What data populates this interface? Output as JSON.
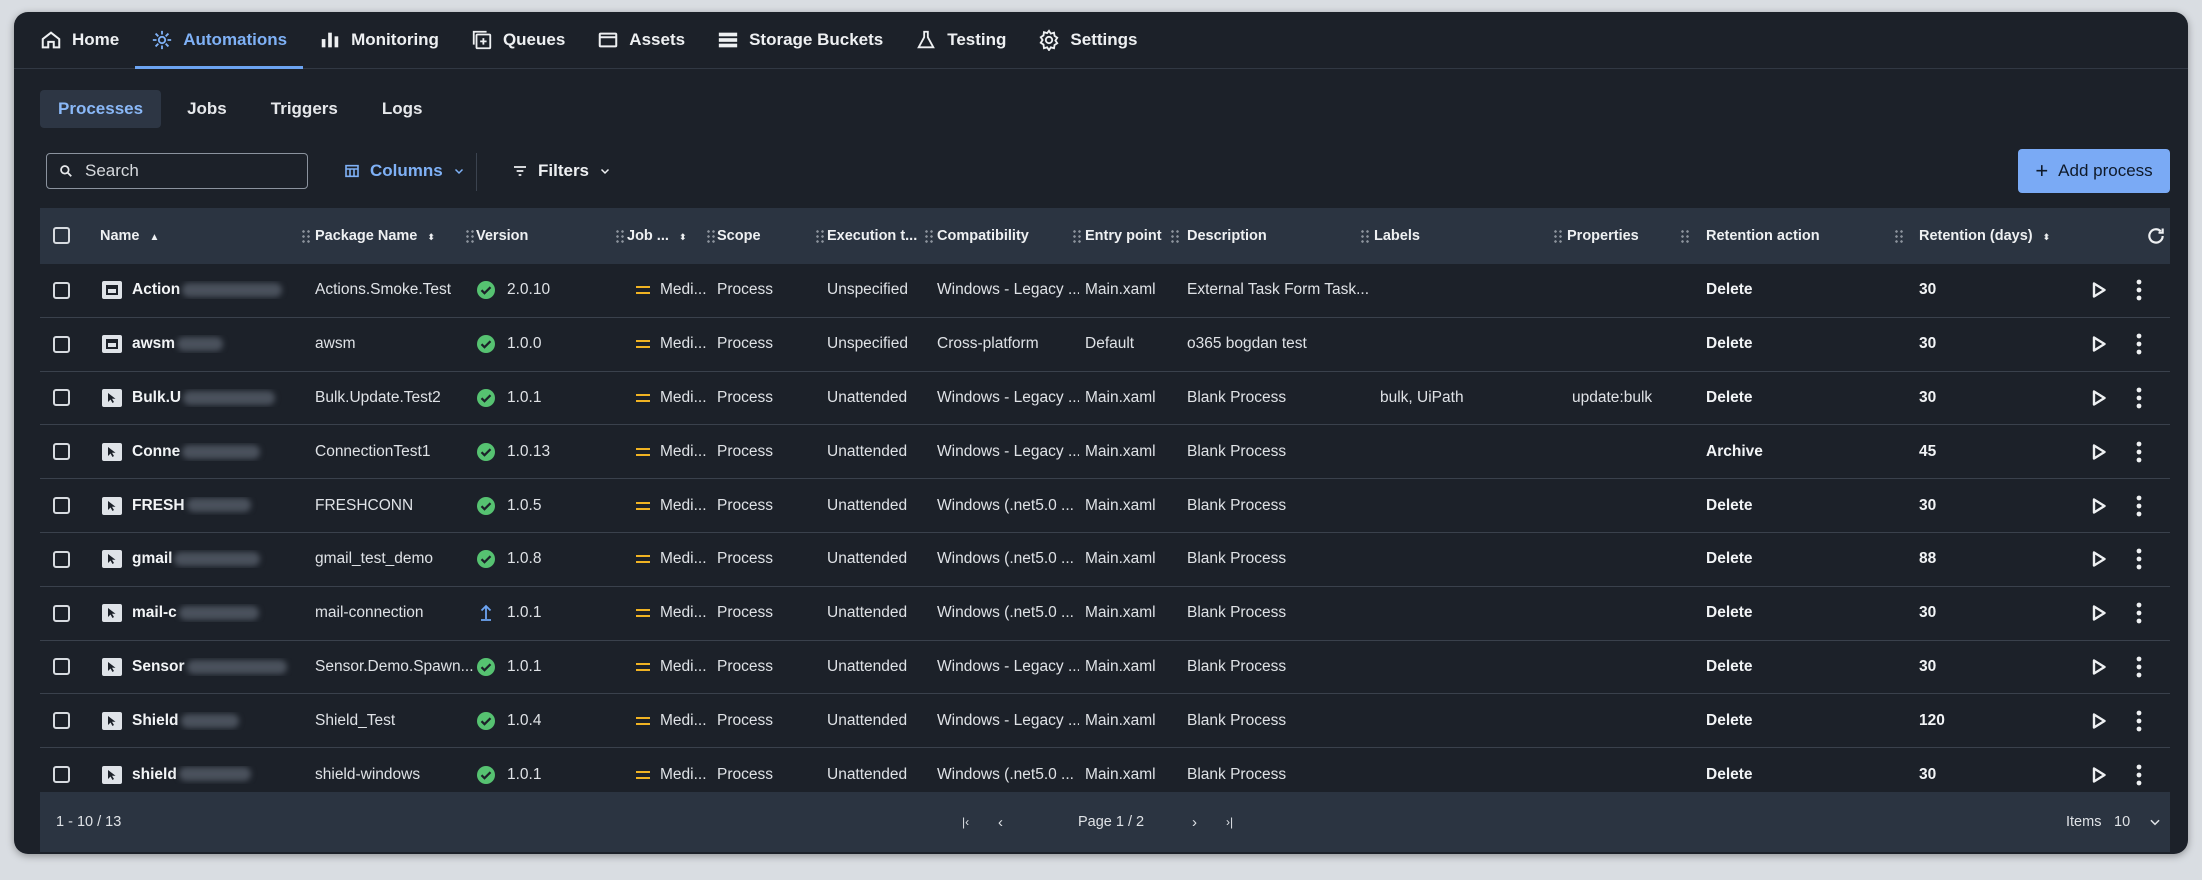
{
  "nav": {
    "items": [
      {
        "label": "Home",
        "icon": "home-icon"
      },
      {
        "label": "Automations",
        "icon": "automations-icon"
      },
      {
        "label": "Monitoring",
        "icon": "monitoring-icon"
      },
      {
        "label": "Queues",
        "icon": "queues-icon"
      },
      {
        "label": "Assets",
        "icon": "assets-icon"
      },
      {
        "label": "Storage Buckets",
        "icon": "storage-icon"
      },
      {
        "label": "Testing",
        "icon": "flask-icon"
      },
      {
        "label": "Settings",
        "icon": "gear-icon"
      }
    ],
    "active": "Automations"
  },
  "subtabs": {
    "items": [
      "Processes",
      "Jobs",
      "Triggers",
      "Logs"
    ],
    "active": "Processes"
  },
  "toolbar": {
    "search_placeholder": "Search",
    "columns_label": "Columns",
    "filters_label": "Filters",
    "add_label": "Add process"
  },
  "table": {
    "headers": {
      "name": "Name",
      "package": "Package Name",
      "version": "Version",
      "job": "Job ...",
      "scope": "Scope",
      "execution": "Execution t...",
      "compatibility": "Compatibility",
      "entry": "Entry point",
      "description": "Description",
      "labels": "Labels",
      "properties": "Properties",
      "retention_action": "Retention action",
      "retention_days": "Retention (days)"
    },
    "rows": [
      {
        "name": "Action",
        "type": "attended",
        "package": "Actions.Smoke.Test",
        "version": "2.0.10",
        "version_status": "ok",
        "job": "Medi...",
        "scope": "Process",
        "execution": "Unspecified",
        "compatibility": "Windows - Legacy ...",
        "entry": "Main.xaml",
        "description": "External Task Form Task...",
        "labels": "",
        "properties": "",
        "retention_action": "Delete",
        "retention_days": "30"
      },
      {
        "name": "awsm",
        "type": "attended",
        "package": "awsm",
        "version": "1.0.0",
        "version_status": "ok",
        "job": "Medi...",
        "scope": "Process",
        "execution": "Unspecified",
        "compatibility": "Cross-platform",
        "entry": "Default",
        "description": "o365 bogdan test",
        "labels": "",
        "properties": "",
        "retention_action": "Delete",
        "retention_days": "30"
      },
      {
        "name": "Bulk.U",
        "type": "unattended",
        "package": "Bulk.Update.Test2",
        "version": "1.0.1",
        "version_status": "ok",
        "job": "Medi...",
        "scope": "Process",
        "execution": "Unattended",
        "compatibility": "Windows - Legacy ...",
        "entry": "Main.xaml",
        "description": "Blank Process",
        "labels": "bulk, UiPath",
        "properties": "update:bulk",
        "retention_action": "Delete",
        "retention_days": "30"
      },
      {
        "name": "Conne",
        "type": "unattended",
        "package": "ConnectionTest1",
        "version": "1.0.13",
        "version_status": "ok",
        "job": "Medi...",
        "scope": "Process",
        "execution": "Unattended",
        "compatibility": "Windows - Legacy ...",
        "entry": "Main.xaml",
        "description": "Blank Process",
        "labels": "",
        "properties": "",
        "retention_action": "Archive",
        "retention_days": "45"
      },
      {
        "name": "FRESH",
        "type": "unattended",
        "package": "FRESHCONN",
        "version": "1.0.5",
        "version_status": "ok",
        "job": "Medi...",
        "scope": "Process",
        "execution": "Unattended",
        "compatibility": "Windows (.net5.0 ...",
        "entry": "Main.xaml",
        "description": "Blank Process",
        "labels": "",
        "properties": "",
        "retention_action": "Delete",
        "retention_days": "30"
      },
      {
        "name": "gmail",
        "type": "unattended",
        "package": "gmail_test_demo",
        "version": "1.0.8",
        "version_status": "ok",
        "job": "Medi...",
        "scope": "Process",
        "execution": "Unattended",
        "compatibility": "Windows (.net5.0 ...",
        "entry": "Main.xaml",
        "description": "Blank Process",
        "labels": "",
        "properties": "",
        "retention_action": "Delete",
        "retention_days": "88"
      },
      {
        "name": "mail-c",
        "type": "unattended",
        "package": "mail-connection",
        "version": "1.0.1",
        "version_status": "upgrade",
        "job": "Medi...",
        "scope": "Process",
        "execution": "Unattended",
        "compatibility": "Windows (.net5.0 ...",
        "entry": "Main.xaml",
        "description": "Blank Process",
        "labels": "",
        "properties": "",
        "retention_action": "Delete",
        "retention_days": "30"
      },
      {
        "name": "Sensor",
        "type": "unattended",
        "package": "Sensor.Demo.Spawn...",
        "version": "1.0.1",
        "version_status": "ok",
        "job": "Medi...",
        "scope": "Process",
        "execution": "Unattended",
        "compatibility": "Windows - Legacy ...",
        "entry": "Main.xaml",
        "description": "Blank Process",
        "labels": "",
        "properties": "",
        "retention_action": "Delete",
        "retention_days": "30"
      },
      {
        "name": "Shield",
        "type": "unattended",
        "package": "Shield_Test",
        "version": "1.0.4",
        "version_status": "ok",
        "job": "Medi...",
        "scope": "Process",
        "execution": "Unattended",
        "compatibility": "Windows - Legacy ...",
        "entry": "Main.xaml",
        "description": "Blank Process",
        "labels": "",
        "properties": "",
        "retention_action": "Delete",
        "retention_days": "120"
      },
      {
        "name": "shield",
        "type": "unattended",
        "package": "shield-windows",
        "version": "1.0.1",
        "version_status": "ok",
        "job": "Medi...",
        "scope": "Process",
        "execution": "Unattended",
        "compatibility": "Windows (.net5.0 ...",
        "entry": "Main.xaml",
        "description": "Blank Process",
        "labels": "",
        "properties": "",
        "retention_action": "Delete",
        "retention_days": "30"
      }
    ]
  },
  "footer": {
    "range": "1 - 10 / 13",
    "page": "Page 1 / 2",
    "items_label": "Items",
    "items_value": "10"
  },
  "colors": {
    "accent": "#7fb1f6",
    "success": "#56c271",
    "warning": "#f0b323",
    "background": "#1c2129",
    "header": "#2b3441"
  }
}
